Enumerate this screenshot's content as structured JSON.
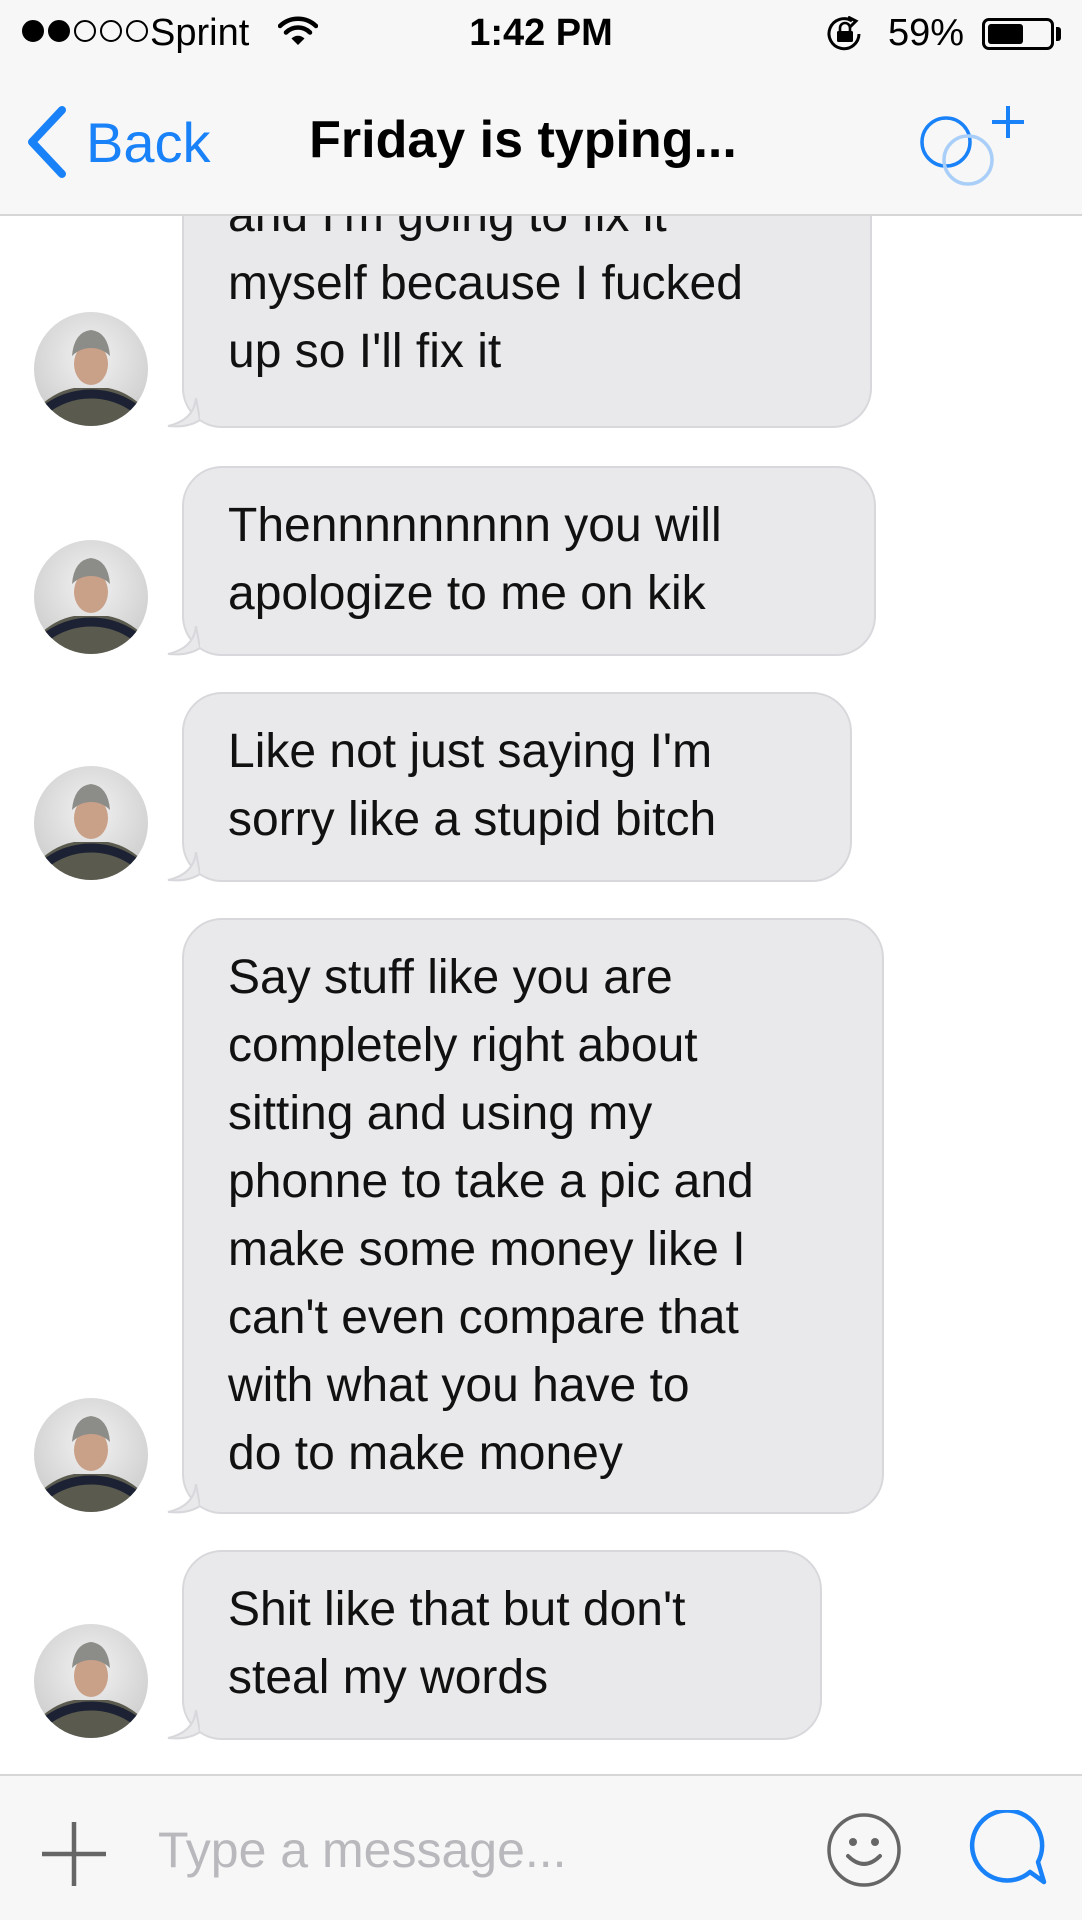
{
  "status_bar": {
    "signal_bars": 2,
    "signal_total": 5,
    "carrier": "Sprint",
    "time": "1:42 PM",
    "battery_percent": "59%",
    "battery_level": 0.59
  },
  "header": {
    "back_label": "Back",
    "title": "Friday is typing..."
  },
  "messages": [
    {
      "text": "and I'm going to fix it\nmyself because I fucked\nup so I'll fix it"
    },
    {
      "text": "Thennnnnnnnn you will\napologize to me on kik"
    },
    {
      "text": "Like not just saying I'm\nsorry like a stupid bitch"
    },
    {
      "text": "Say stuff like you are\ncompletely right about\nsitting and using my\nphonne to take a pic and\nmake some money like I\ncan't even compare that\nwith what you have to\ndo to make money"
    },
    {
      "text": "Shit like that but don't\nsteal my words"
    }
  ],
  "composer": {
    "placeholder": "Type a message..."
  },
  "colors": {
    "accent": "#1a82f8",
    "bubble": "#e9e9eb",
    "bar": "#f7f7f7"
  }
}
